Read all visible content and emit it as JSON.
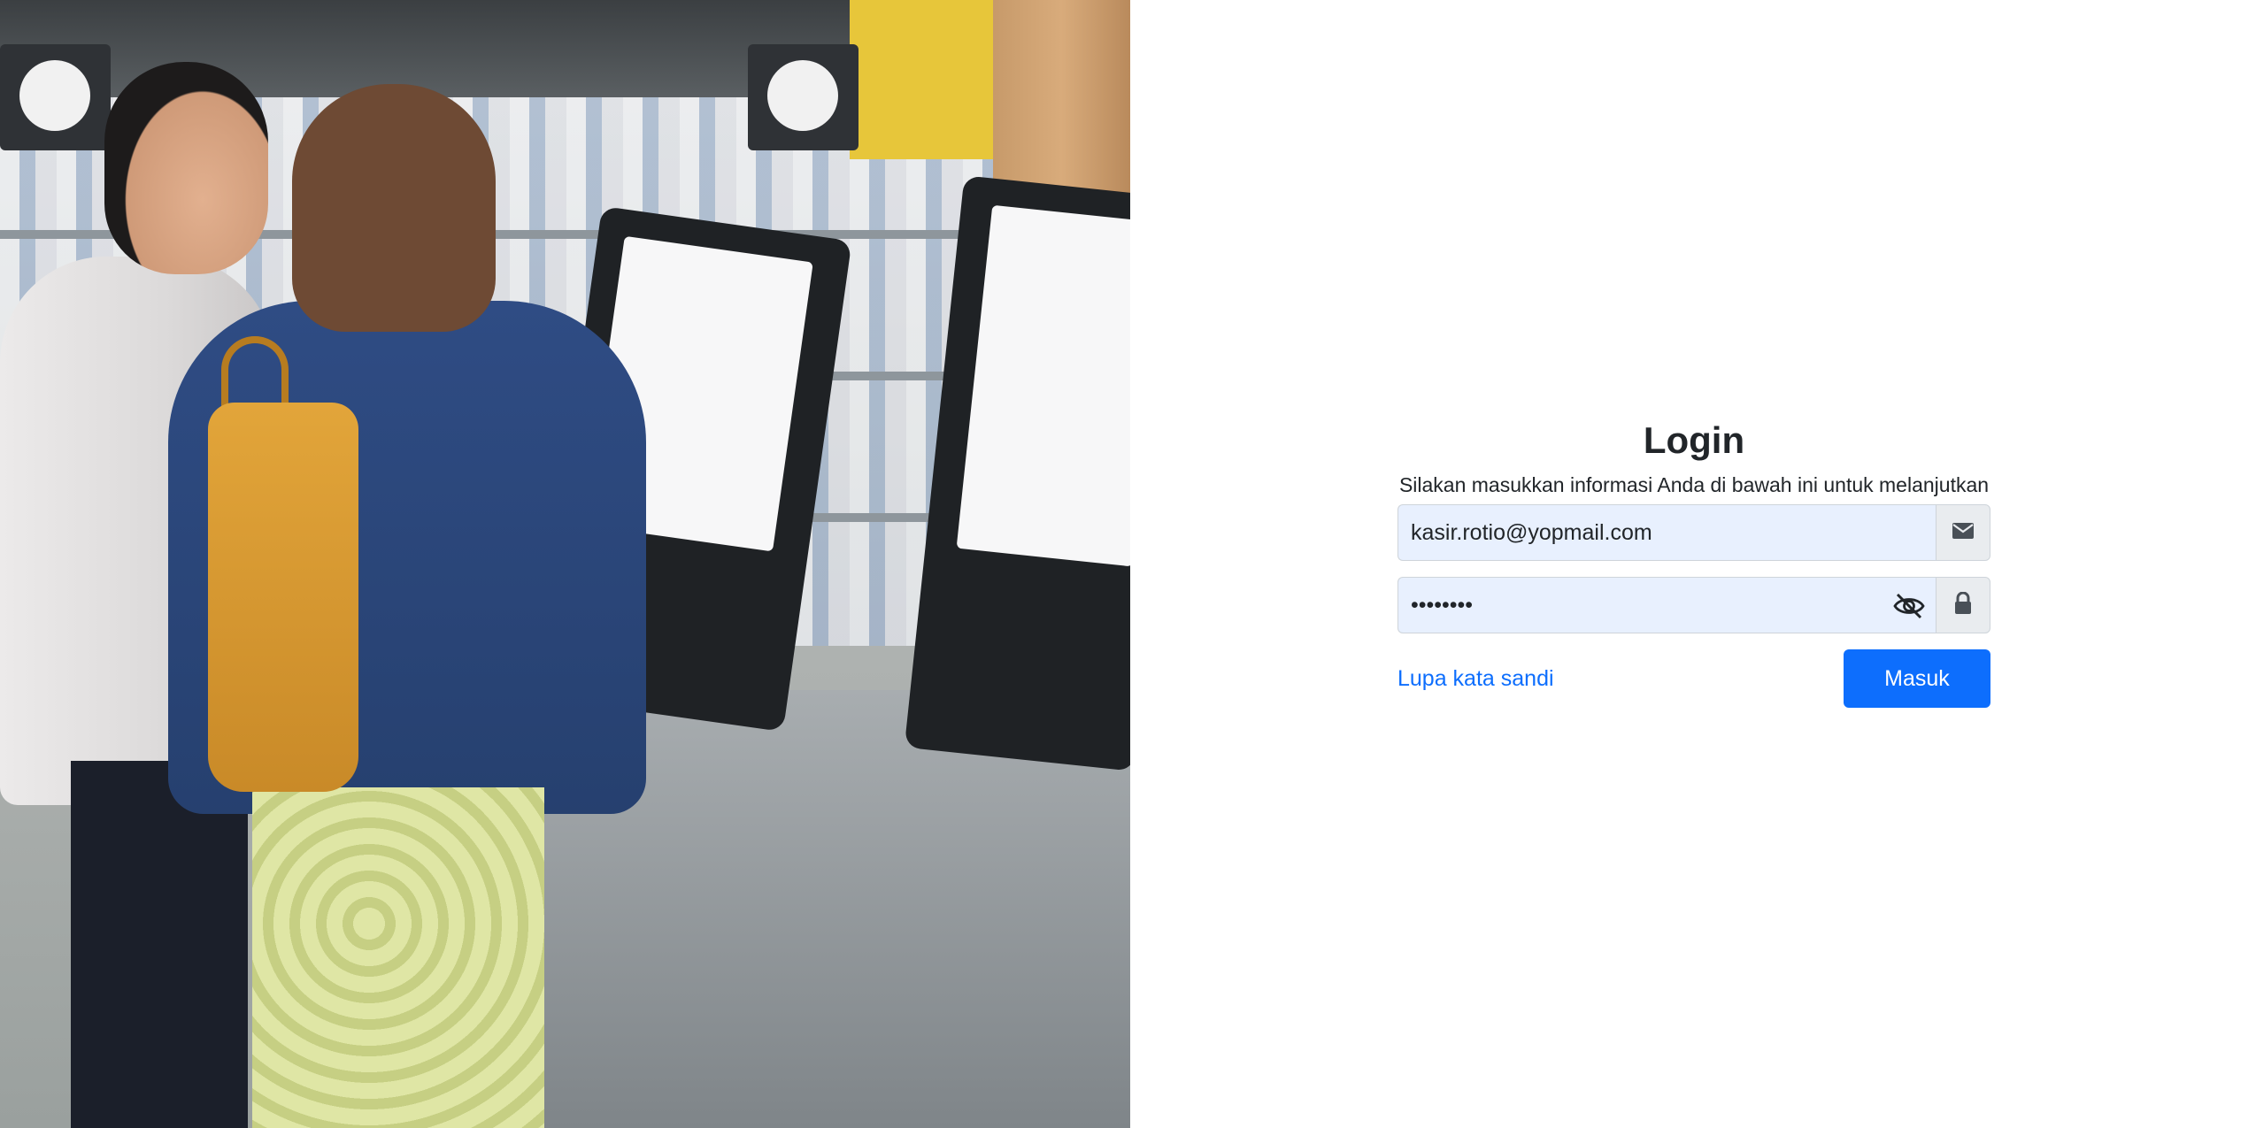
{
  "hero_image": {
    "icon": "self-checkout-photo"
  },
  "login": {
    "title": "Login",
    "subtitle": "Silakan masukkan informasi Anda di bawah ini untuk melanjutkan",
    "email": {
      "value": "kasir.rotio@yopmail.com",
      "icon": "envelope-icon"
    },
    "password": {
      "value": "••••••••",
      "toggle_icon": "eye-slash-icon",
      "icon": "lock-icon"
    },
    "forgot_password_label": "Lupa kata sandi",
    "submit_label": "Masuk"
  },
  "colors": {
    "primary": "#0d6efd",
    "input_autofill_bg": "#e8f0fe",
    "addon_bg": "#e9ecef",
    "text": "#212529"
  }
}
